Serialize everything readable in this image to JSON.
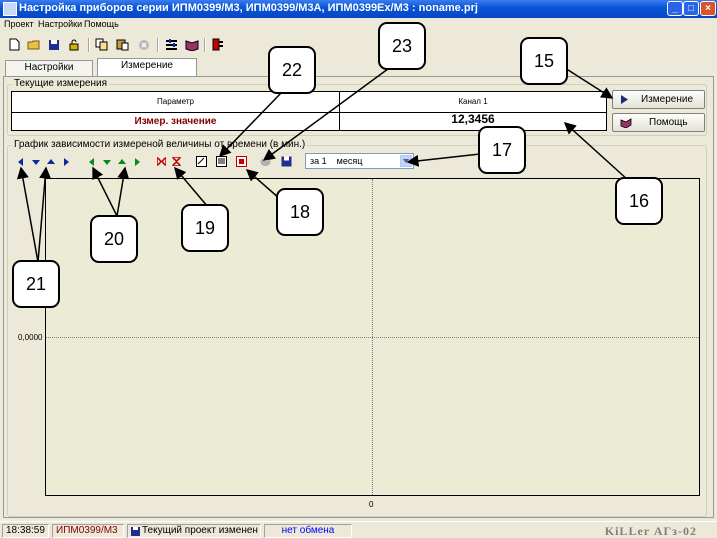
{
  "window": {
    "title": "Настройка приборов серии ИПМ0399/М3, ИПМ0399/М3А, ИПМ0399Ex/М3 : noname.prj",
    "controls": [
      "_",
      "□",
      "×"
    ]
  },
  "menu": [
    "Проект",
    "Настройки",
    "Помощь"
  ],
  "toolbar": {
    "icons": [
      "new-file-icon",
      "open-folder-icon",
      "save-icon",
      "unlock-icon",
      "copy-icon",
      "paste-icon",
      "stop-circle-icon",
      "settings-icon",
      "book-icon",
      "device-icon"
    ]
  },
  "tabs": [
    {
      "label": "Настройки",
      "active": false
    },
    {
      "label": "Измерение",
      "active": true
    }
  ],
  "current_measurements": {
    "legend": "Текущие измерения",
    "col_param": "Параметр",
    "col_channel": "Канал 1",
    "row_label": "Измер. значение",
    "row_value": "12,3456",
    "row_label_color": "#800000"
  },
  "buttons": {
    "measure": "Измерение",
    "help": "Помощь"
  },
  "graph": {
    "legend": "График зависимости измереной величины от времени (в мин.)",
    "period": "за 1    месяц",
    "y_tick": "0,0000",
    "x_tick": "0",
    "bg_color": "#ebebd6"
  },
  "status": {
    "time": "18:38:59",
    "device": "ИПМ0399/М3",
    "project": "Текущий проект изменен",
    "exchange": "нет обмена",
    "signature": "KiLLer АГз-02",
    "device_color": "#800000",
    "exchange_color": "#0000ff"
  },
  "callouts": [
    "15",
    "16",
    "17",
    "18",
    "19",
    "20",
    "21",
    "22",
    "23"
  ]
}
